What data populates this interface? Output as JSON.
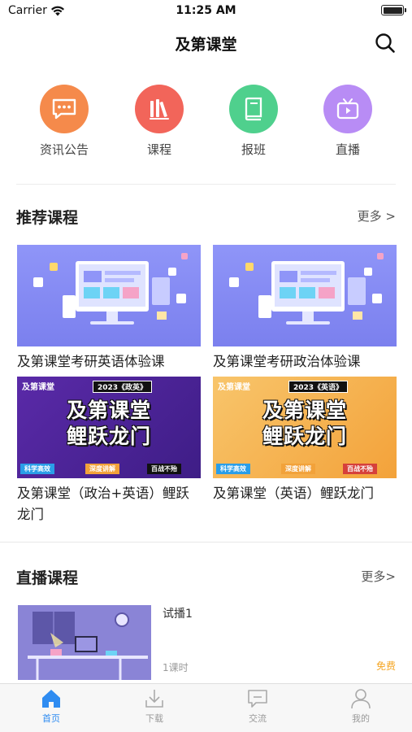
{
  "status_bar": {
    "carrier": "Carrier",
    "time": "11:25 AM"
  },
  "nav": {
    "title": "及第课堂"
  },
  "categories": [
    {
      "label": "资讯公告",
      "icon": "message-icon",
      "color": "#f58a4b"
    },
    {
      "label": "课程",
      "icon": "books-icon",
      "color": "#f2655a"
    },
    {
      "label": "报班",
      "icon": "book-icon",
      "color": "#4fd08d"
    },
    {
      "label": "直播",
      "icon": "tv-icon",
      "color": "#b88cf5"
    }
  ],
  "recommended": {
    "title": "推荐课程",
    "more": "更多 >",
    "courses": [
      {
        "title": "及第课堂考研英语体验课"
      },
      {
        "title": "及第课堂考研政治体验课"
      },
      {
        "title": "及第课堂（政治+英语）鲤跃龙门",
        "promo": {
          "logo": "及第课堂",
          "year": "2023《政英》",
          "line1": "及第课堂",
          "line2": "鲤跃龙门",
          "tag1": "科学高效",
          "tag2": "深度讲解",
          "tag3": "百战不殆"
        }
      },
      {
        "title": "及第课堂（英语）鲤跃龙门",
        "promo": {
          "logo": "及第课堂",
          "year": "2023《英语》",
          "line1": "及第课堂",
          "line2": "鲤跃龙门",
          "tag1": "科学高效",
          "tag2": "深度讲解",
          "tag3": "百战不殆"
        }
      }
    ]
  },
  "live": {
    "title": "直播课程",
    "more": "更多>",
    "course": {
      "title": "试播1",
      "hours": "1课时",
      "price": "免费"
    }
  },
  "tabs": [
    {
      "label": "首页",
      "icon": "home-icon",
      "active": true
    },
    {
      "label": "下载",
      "icon": "download-icon",
      "active": false
    },
    {
      "label": "交流",
      "icon": "chat-icon",
      "active": false
    },
    {
      "label": "我的",
      "icon": "person-icon",
      "active": false
    }
  ],
  "colors": {
    "accent": "#2f8cf1",
    "price": "#f5a623"
  }
}
